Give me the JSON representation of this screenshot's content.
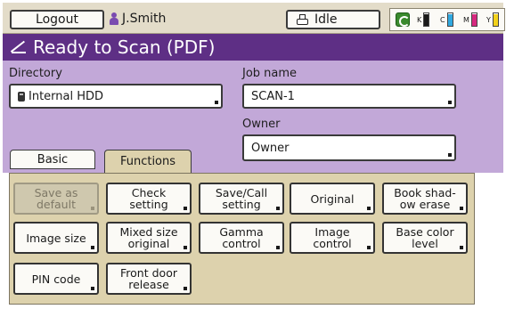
{
  "header": {
    "logout_label": "Logout",
    "user_name": "J.Smith",
    "status_label": "Idle",
    "toners": [
      {
        "label": "K",
        "color": "#1a1a1a",
        "level": 0.9
      },
      {
        "label": "C",
        "color": "#2fa8e0",
        "level": 0.9
      },
      {
        "label": "M",
        "color": "#d6287f",
        "level": 0.9
      },
      {
        "label": "Y",
        "color": "#f2d21c",
        "level": 0.9
      }
    ]
  },
  "title": {
    "icon": "scan-icon",
    "text": "Ready to Scan (PDF)"
  },
  "form": {
    "directory_label": "Directory",
    "directory_value": "Internal HDD",
    "job_name_label": "Job name",
    "job_name_value": "SCAN-1",
    "owner_label": "Owner",
    "owner_value": "Owner"
  },
  "tabs": [
    {
      "label": "Basic",
      "active": false
    },
    {
      "label": "Functions",
      "active": true
    }
  ],
  "functions": [
    {
      "label": "Save as\ndefault",
      "enabled": false
    },
    {
      "label": "Check\nsetting",
      "enabled": true
    },
    {
      "label": "Save/Call\nsetting",
      "enabled": true
    },
    {
      "label": "Original",
      "enabled": true
    },
    {
      "label": "Book shad-\now erase",
      "enabled": true
    },
    {
      "label": "Image size",
      "enabled": true
    },
    {
      "label": "Mixed size\noriginal",
      "enabled": true
    },
    {
      "label": "Gamma\ncontrol",
      "enabled": true
    },
    {
      "label": "Image\ncontrol",
      "enabled": true
    },
    {
      "label": "Base color\nlevel",
      "enabled": true
    },
    {
      "label": "PIN code",
      "enabled": true
    },
    {
      "label": "Front door\nrelease",
      "enabled": true
    }
  ],
  "colors": {
    "title_bg": "#5e2f85",
    "panel_bg": "#c2a8d8",
    "function_area_bg": "#ddd2ad"
  }
}
